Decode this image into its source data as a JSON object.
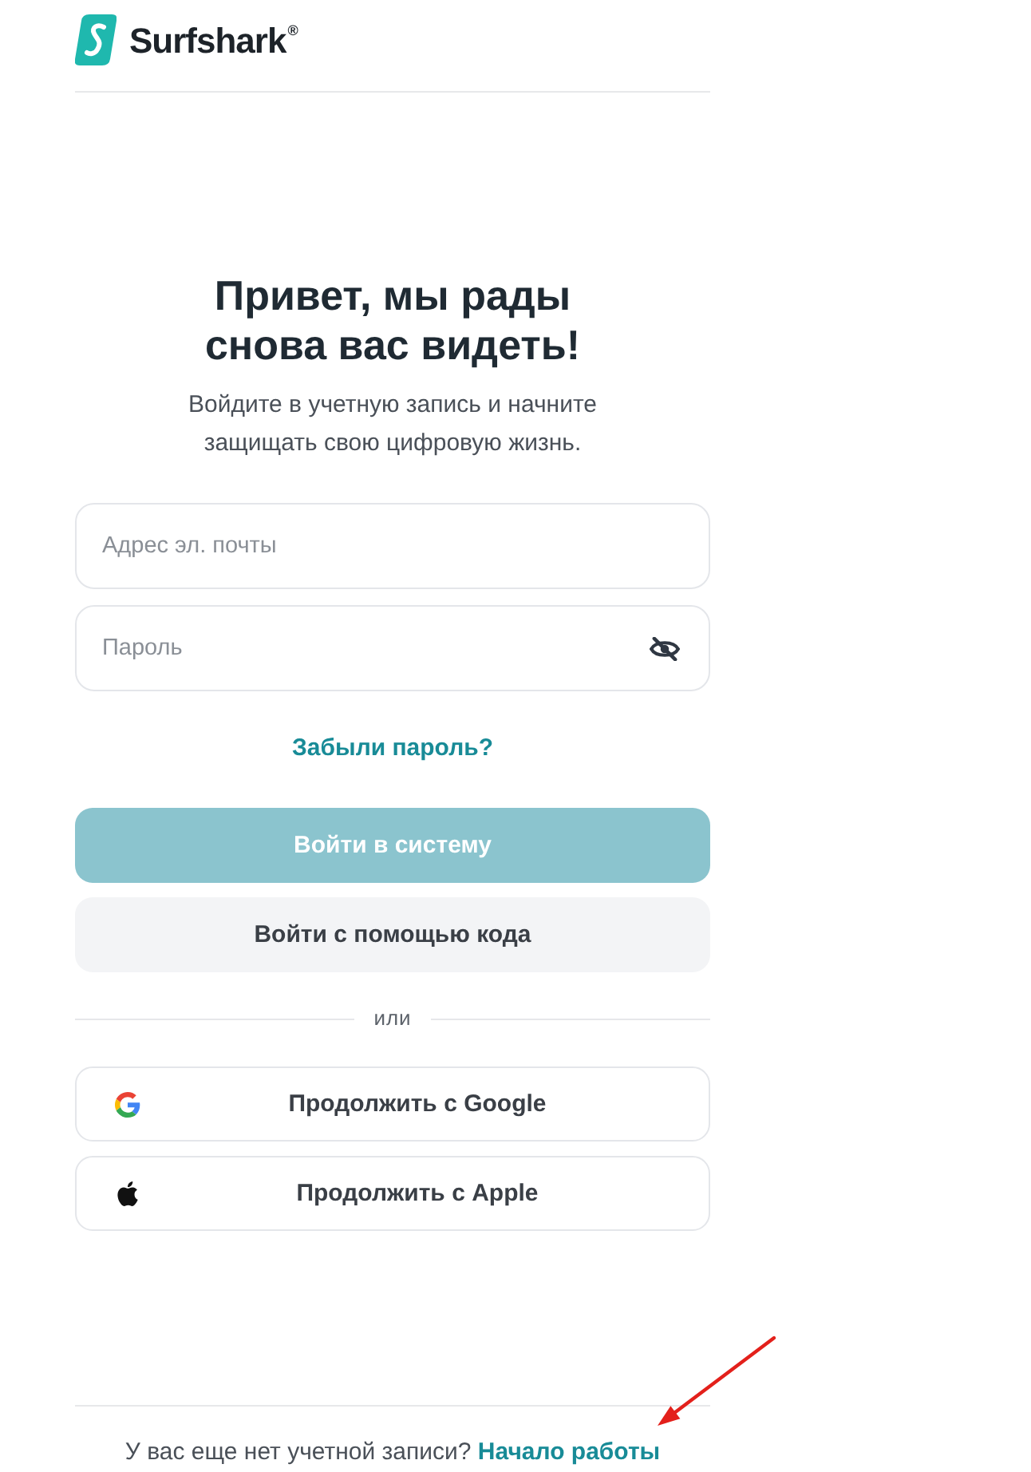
{
  "header": {
    "logo": "Surfshark$^{®}$"
  },
  "heading": "Привет, мы рады снова вас видеть!",
  "subtitle": "Войдите в учетную запись и начните защищать свою цифровую жизнь.",
  "fields": [
    {
      "kind": "email",
      "placeholder": "Адрес эл. почты"
    },
    {
      "kind": "password",
      "placeholder": "Пароль",
      "revealed": false
    }
  ],
  "forgot_link": "Забыли пароль?",
  "buttons": [
    {
      "kind": "primary",
      "label": "Войти в систему",
      "disabled": true
    },
    {
      "kind": "secondary",
      "label": "Войти с помощью кода",
      "disabled": false
    }
  ],
  "divider_text": "или",
  "social_buttons": [
    {
      "kind": "google",
      "label": "Продолжить с Google"
    },
    {
      "kind": "apple",
      "label": "Продолжить с Apple"
    }
  ],
  "footer": {
    "text": "У вас еще нет учетной записи?",
    "link": "Начало работы"
  },
  "annotation": {
    "kind": "arrow"
  }
}
